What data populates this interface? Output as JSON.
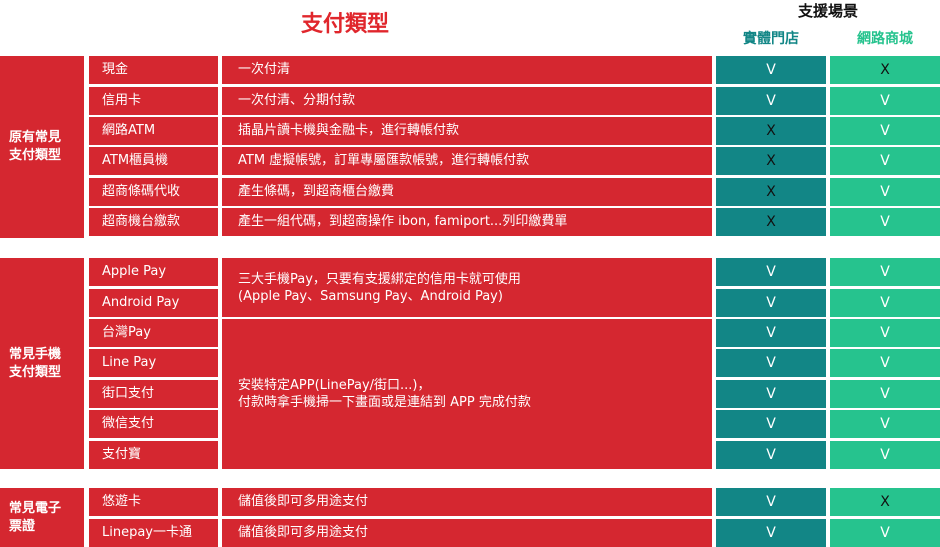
{
  "header": {
    "title": "支付類型",
    "scenarios_title": "支援場景",
    "store_label": "實體門店",
    "online_label": "網路商城"
  },
  "colors": {
    "primary_red": "#d52730",
    "store_teal": "#128686",
    "online_green": "#26c38e",
    "title_red": "#e0262c",
    "store_label": "#128686",
    "online_label": "#26c38e"
  },
  "groups": [
    {
      "label_line1": "原有常見",
      "label_line2": "支付類型",
      "rows": [
        {
          "name": "現金",
          "desc": "一次付清",
          "store": "V",
          "online": "X"
        },
        {
          "name": "信用卡",
          "desc": "一次付清、分期付款",
          "store": "V",
          "online": "V"
        },
        {
          "name": "網路ATM",
          "desc": "插晶片讀卡機與金融卡，進行轉帳付款",
          "store": "X",
          "online": "V"
        },
        {
          "name": "ATM櫃員機",
          "desc": "ATM 虛擬帳號，訂單專屬匯款帳號，進行轉帳付款",
          "store": "X",
          "online": "V"
        },
        {
          "name": "超商條碼代收",
          "desc": "產生條碼，到超商櫃台繳費",
          "store": "X",
          "online": "V"
        },
        {
          "name": "超商機台繳款",
          "desc": "產生一組代碼，到超商操作 ibon, famiport...列印繳費單",
          "store": "X",
          "online": "V"
        }
      ]
    },
    {
      "label_line1": "常見手機",
      "label_line2": "支付類型",
      "desc_a_line1": "三大手機Pay，只要有支援綁定的信用卡就可使用",
      "desc_a_line2": "(Apple Pay、Samsung Pay、Android Pay)",
      "desc_b_line1": "安裝特定APP(LinePay/街口...)，",
      "desc_b_line2": "付款時拿手機掃一下畫面或是連結到 APP 完成付款",
      "rows": [
        {
          "name": "Apple Pay",
          "store": "V",
          "online": "V"
        },
        {
          "name": "Android Pay",
          "store": "V",
          "online": "V"
        },
        {
          "name": "台灣Pay",
          "store": "V",
          "online": "V"
        },
        {
          "name": "Line Pay",
          "store": "V",
          "online": "V"
        },
        {
          "name": "街口支付",
          "store": "V",
          "online": "V"
        },
        {
          "name": "微信支付",
          "store": "V",
          "online": "V"
        },
        {
          "name": "支付寶",
          "store": "V",
          "online": "V"
        }
      ]
    },
    {
      "label_line1": "常見電子",
      "label_line2": "票證",
      "rows": [
        {
          "name": "悠遊卡",
          "desc": "儲值後即可多用途支付",
          "store": "V",
          "online": "X"
        },
        {
          "name": "Linepay一卡通",
          "desc": "儲值後即可多用途支付",
          "store": "V",
          "online": "V"
        }
      ]
    }
  ]
}
